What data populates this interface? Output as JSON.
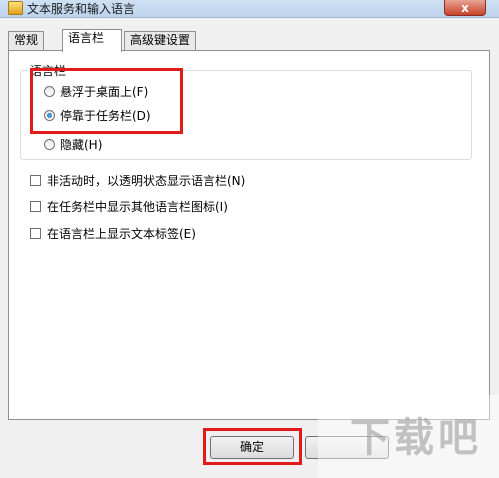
{
  "window": {
    "title": "文本服务和输入语言",
    "close_label": "x"
  },
  "tabs": [
    {
      "label": "常规"
    },
    {
      "label": "语言栏"
    },
    {
      "label": "高级键设置"
    }
  ],
  "language_bar_group": {
    "title": "语言栏",
    "options": [
      {
        "label": "悬浮于桌面上(F)",
        "checked": false
      },
      {
        "label": "停靠于任务栏(D)",
        "checked": true
      },
      {
        "label": "隐藏(H)",
        "checked": false
      }
    ]
  },
  "checkboxes": [
    {
      "label": "非活动时，以透明状态显示语言栏(N)",
      "checked": false
    },
    {
      "label": "在任务栏中显示其他语言栏图标(I)",
      "checked": false
    },
    {
      "label": "在语言栏上显示文本标签(E)",
      "checked": false
    }
  ],
  "buttons": {
    "ok_label": "确定"
  },
  "watermark": {
    "logo_text": "下载吧"
  },
  "colors": {
    "highlight": "#e11a1a"
  }
}
